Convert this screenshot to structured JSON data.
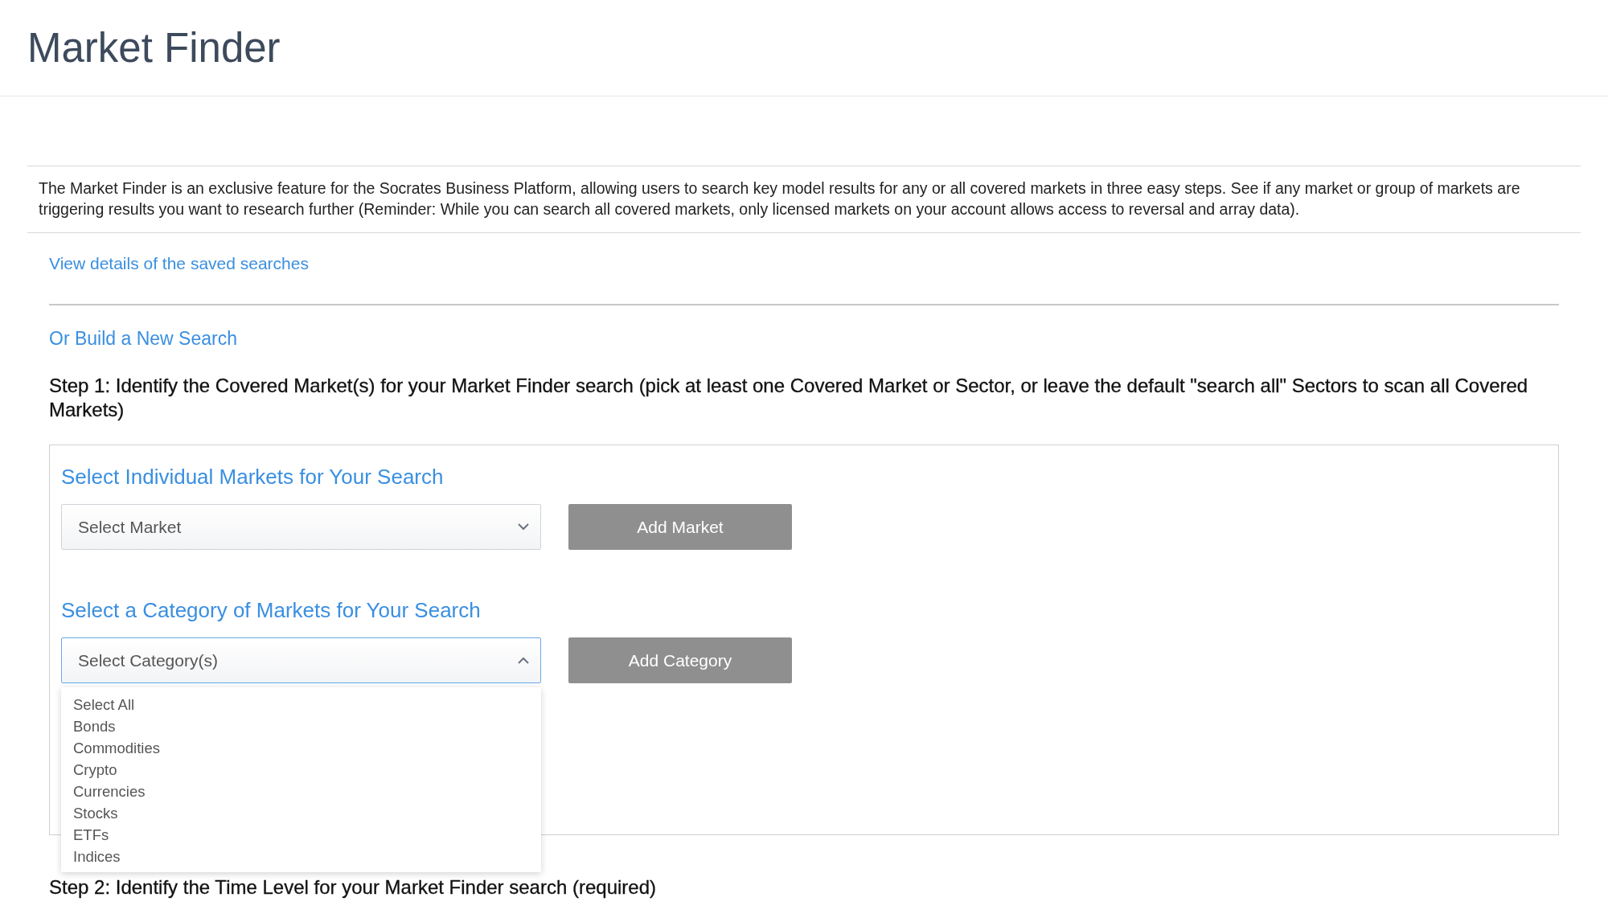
{
  "page": {
    "title": "Market Finder"
  },
  "intro": "The Market Finder is an exclusive feature for the Socrates Business Platform, allowing users to search key model results for any or all covered markets in three easy steps. See if any market or group of markets are triggering results you want to research further (Reminder: While you can search all covered markets, only licensed markets on your account allows access to reversal and array data).",
  "saved_link": "View details of the saved searches",
  "build_heading": "Or Build a New Search",
  "step1": "Step 1: Identify the Covered Market(s) for your Market Finder search (pick at least one Covered Market or Sector, or leave the default \"search all\" Sectors to scan all Covered Markets)",
  "markets": {
    "heading": "Select Individual Markets for Your Search",
    "select": {
      "placeholder": "Select Market",
      "expanded": false
    },
    "button": {
      "label": "Add Market",
      "disabled": true
    }
  },
  "categories": {
    "heading": "Select a Category of Markets for Your Search",
    "select": {
      "placeholder": "Select Category(s)",
      "expanded": true
    },
    "button": {
      "label": "Add Category",
      "disabled": true
    },
    "options": [
      "Select All",
      "Bonds",
      "Commodities",
      "Crypto",
      "Currencies",
      "Stocks",
      "ETFs",
      "Indices"
    ]
  },
  "step2": "Step 2: Identify the Time Level for your Market Finder search (required)"
}
